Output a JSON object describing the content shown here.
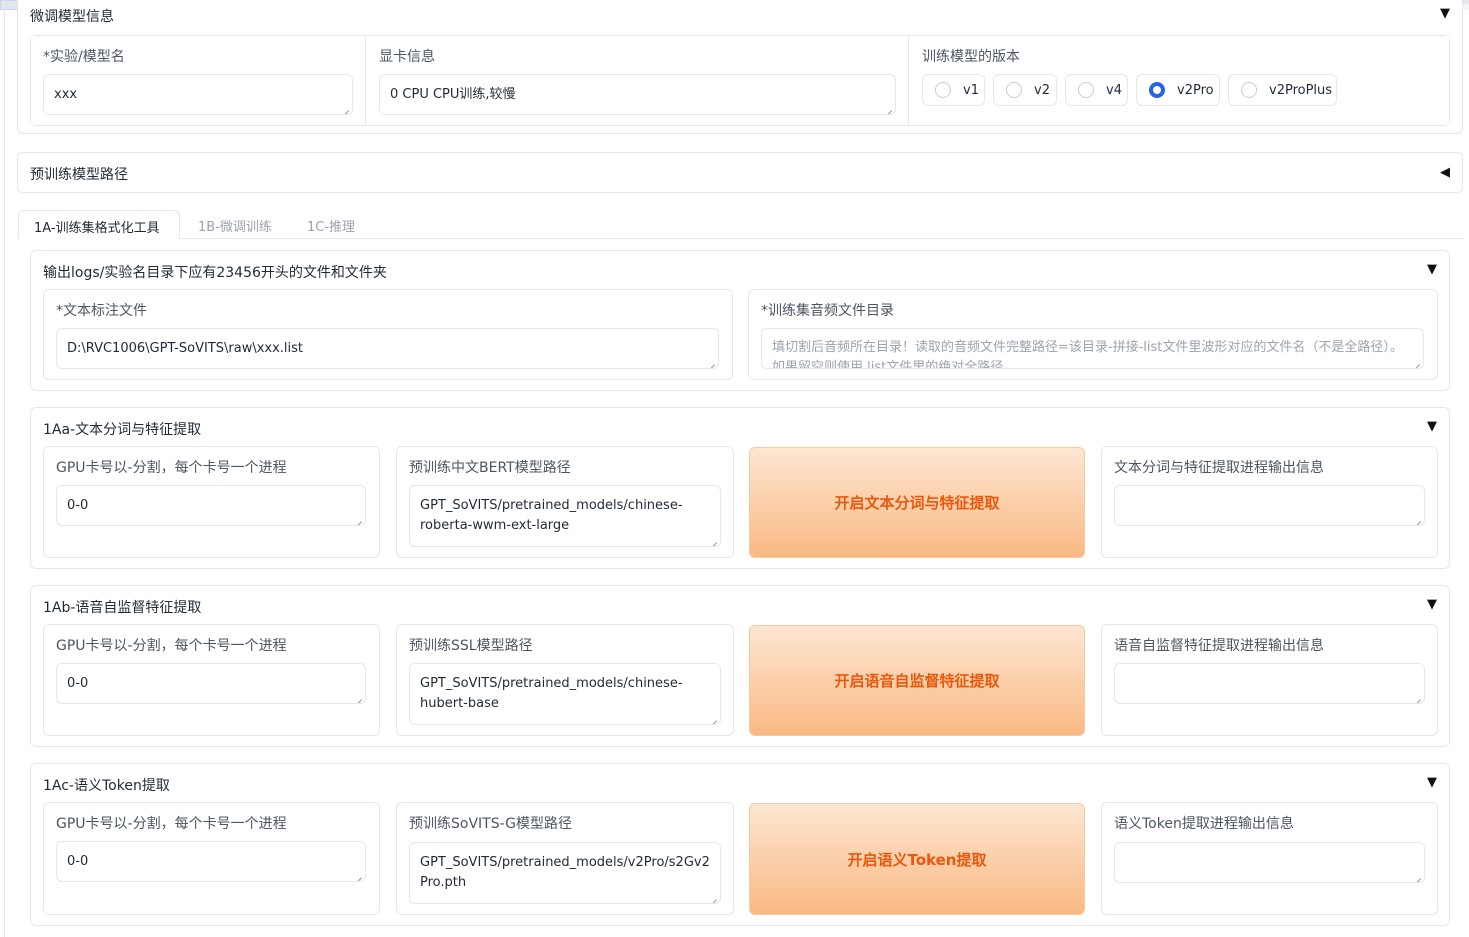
{
  "finetune_info": {
    "title": "微调模型信息",
    "exp_name_label": "*实验/模型名",
    "exp_name_value": "xxx",
    "gpu_info_label": "显卡信息",
    "gpu_info_value": "0 CPU CPU训练,较慢",
    "version_label": "训练模型的版本",
    "versions": [
      "v1",
      "v2",
      "v4",
      "v2Pro",
      "v2ProPlus"
    ],
    "selected_version": "v2Pro"
  },
  "pretrained_paths": {
    "title": "预训练模型路径"
  },
  "tabs": [
    "1A-训练集格式化工具",
    "1B-微调训练",
    "1C-推理"
  ],
  "active_tab": "1A-训练集格式化工具",
  "output_section": {
    "title": "输出logs/实验名目录下应有23456开头的文件和文件夹",
    "text_label_file_label": "*文本标注文件",
    "text_label_file_value": "D:\\RVC1006\\GPT-SoVITS\\raw\\xxx.list",
    "audio_dir_label": "*训练集音频文件目录",
    "audio_dir_placeholder": "填切割后音频所在目录！读取的音频文件完整路径=该目录-拼接-list文件里波形对应的文件名（不是全路径）。如果留空则使用.list文件里的绝对全路径。"
  },
  "s1a": {
    "title": "1Aa-文本分词与特征提取",
    "gpu_label": "GPU卡号以-分割，每个卡号一个进程",
    "gpu_value": "0-0",
    "model_label": "预训练中文BERT模型路径",
    "model_value": "GPT_SoVITS/pretrained_models/chinese-roberta-wwm-ext-large",
    "button": "开启文本分词与特征提取",
    "output_label": "文本分词与特征提取进程输出信息",
    "output_value": ""
  },
  "s1b": {
    "title": "1Ab-语音自监督特征提取",
    "gpu_label": "GPU卡号以-分割，每个卡号一个进程",
    "gpu_value": "0-0",
    "model_label": "预训练SSL模型路径",
    "model_value": "GPT_SoVITS/pretrained_models/chinese-hubert-base",
    "button": "开启语音自监督特征提取",
    "output_label": "语音自监督特征提取进程输出信息",
    "output_value": ""
  },
  "s1c": {
    "title": "1Ac-语义Token提取",
    "gpu_label": "GPU卡号以-分割，每个卡号一个进程",
    "gpu_value": "0-0",
    "model_label": "预训练SoVITS-G模型路径",
    "model_value": "GPT_SoVITS/pretrained_models/v2Pro/s2Gv2Pro.pth",
    "button": "开启语义Token提取",
    "output_label": "语义Token提取进程输出信息",
    "output_value": ""
  },
  "carets": {
    "open": "▼",
    "closed": "◀"
  },
  "colors": {
    "accent": "#ea580c",
    "radio_selected": "#2563eb",
    "border": "#e5e7eb"
  }
}
